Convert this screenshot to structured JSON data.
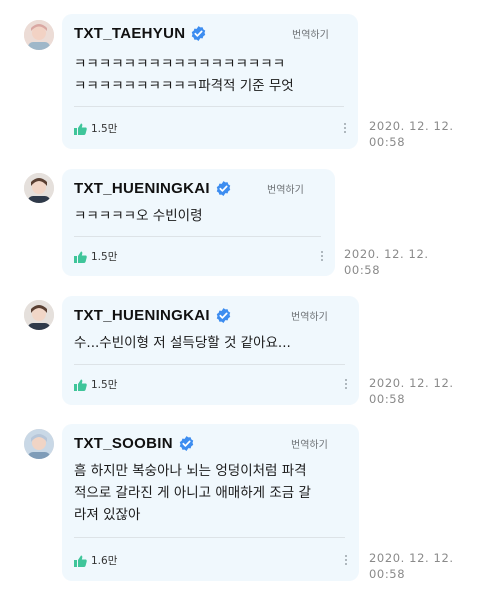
{
  "comments": [
    {
      "username": "TXT_TAEHYUN",
      "translate_label": "번역하기",
      "text": "ㅋㅋㅋㅋㅋㅋㅋㅋㅋㅋㅋㅋㅋㅋㅋㅋㅋ\nㅋㅋㅋㅋㅋㅋㅋㅋㅋㅋ파격적 기준 무엇",
      "likes": "1.5만",
      "time": "2020. 12. 12.\n00:58"
    },
    {
      "username": "TXT_HUENINGKAI",
      "translate_label": "번역하기",
      "text": "ㅋㅋㅋㅋㅋ오 수빈이령",
      "likes": "1.5만",
      "time": "2020. 12. 12.\n00:58"
    },
    {
      "username": "TXT_HUENINGKAI",
      "translate_label": "번역하기",
      "text": "수...수빈이형 저 설득당할 것 같아요...",
      "likes": "1.5만",
      "time": "2020. 12. 12.\n00:58"
    },
    {
      "username": "TXT_SOOBIN",
      "translate_label": "번역하기",
      "text": "흠 하지만 복숭아나 뇌는 엉덩이처럼 파격\n적으로 갈라진 게 아니고 애매하게 조금 갈\n라져 있잖아",
      "likes": "1.6만",
      "time": "2020. 12. 12.\n00:58"
    }
  ],
  "colors": {
    "bubble": "#f0f8fd",
    "verified": "#3d8df0",
    "like": "#3fc59a"
  }
}
